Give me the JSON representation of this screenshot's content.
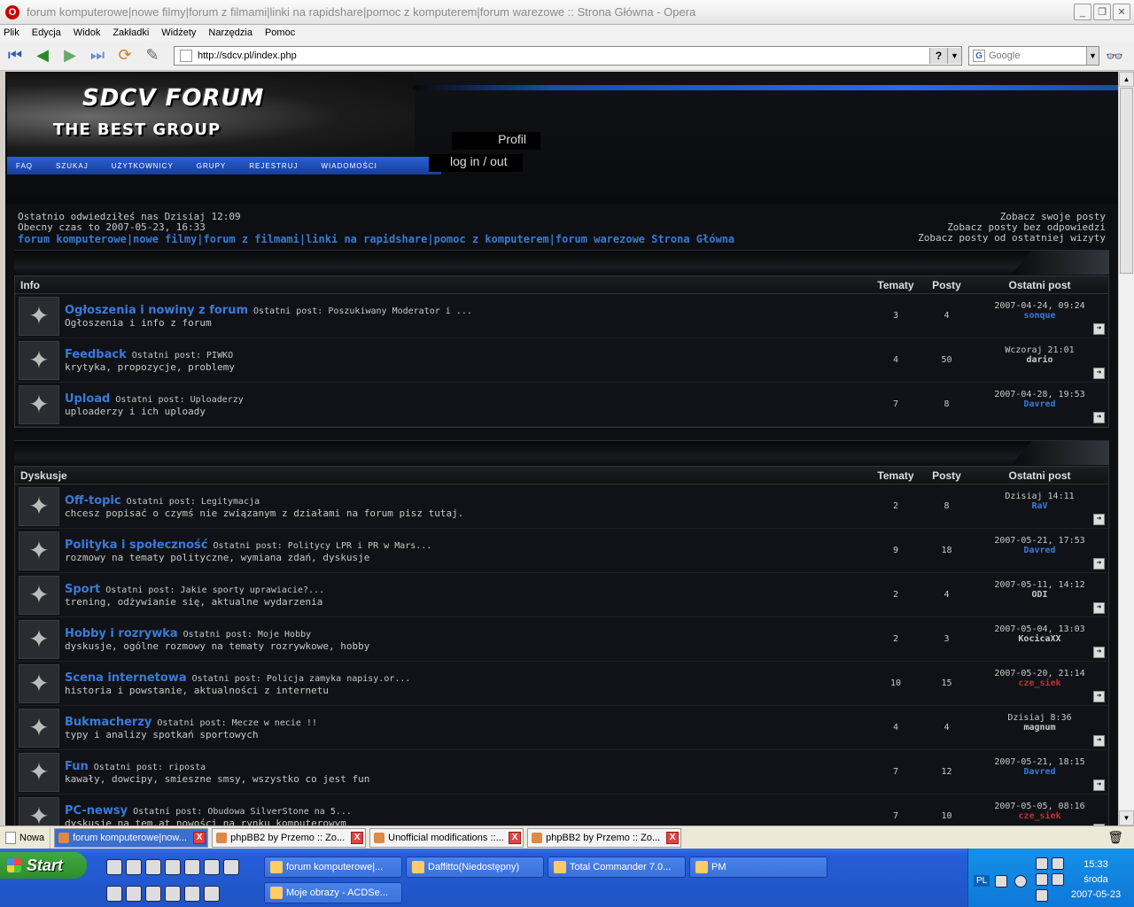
{
  "window": {
    "title": "forum komputerowe|nowe filmy|forum z filmami|linki na rapidshare|pomoc z komputerem|forum warezowe :: Strona Główna - Opera",
    "app_glyph": "O"
  },
  "menu": [
    "Plik",
    "Edycja",
    "Widok",
    "Zakładki",
    "Widżety",
    "Narzędzia",
    "Pomoc"
  ],
  "address": {
    "url": "http://sdcv.pl/index.php",
    "help": "?",
    "search_placeholder": "Google"
  },
  "header": {
    "logo_line1": "SDCV FORUM",
    "logo_line2": "THE BEST GROUP",
    "nav": [
      "FAQ",
      "SZUKAJ",
      "UŻYTKOWNICY",
      "GRUPY",
      "REJESTRUJ",
      "WIADOMOŚCI"
    ],
    "profil": "Profil",
    "login": "log in / out"
  },
  "info": {
    "last_visit": "Ostatnio odwiedziłeś nas Dzisiaj 12:09",
    "current_time": "Obecny czas to 2007-05-23, 16:33",
    "breadcrumb": "forum komputerowe|nowe filmy|forum z filmami|linki na rapidshare|pomoc z komputerem|forum warezowe Strona Główna",
    "links": [
      "Zobacz swoje posty",
      "Zobacz posty bez odpowiedzi",
      "Zobacz posty od ostatniej wizyty"
    ]
  },
  "columns": {
    "tematy": "Tematy",
    "posty": "Posty",
    "ostatni": "Ostatni post"
  },
  "categories": [
    {
      "name": "Info",
      "forums": [
        {
          "name": "Ogłoszenia i nowiny z forum",
          "last": "Ostatni post: Poszukiwany Moderator i ...",
          "desc": "Ogłoszenia i info z forum",
          "topics": "3",
          "posts": "4",
          "date": "2007-04-24, 09:24",
          "user": "sonque",
          "ucolor": "#3a7ad8"
        },
        {
          "name": "Feedback",
          "last": "Ostatni post: PIWKO",
          "desc": "krytyka, propozycje, problemy",
          "topics": "4",
          "posts": "50",
          "date": "Wczoraj 21:01",
          "user": "dario",
          "ucolor": "#c8c8c8"
        },
        {
          "name": "Upload",
          "last": "Ostatni post: Uploaderzy",
          "desc": "uploaderzy i ich uploady",
          "topics": "7",
          "posts": "8",
          "date": "2007-04-28, 19:53",
          "user": "Davred",
          "ucolor": "#3a7ad8"
        }
      ]
    },
    {
      "name": "Dyskusje",
      "forums": [
        {
          "name": "Off-topic",
          "last": "Ostatni post: Legitymacja",
          "desc": "chcesz popisać o czymś nie związanym z działami na forum pisz tutaj.",
          "topics": "2",
          "posts": "8",
          "date": "Dzisiaj 14:11",
          "user": "RaV",
          "ucolor": "#3a7ad8"
        },
        {
          "name": "Polityka i społeczność",
          "last": "Ostatni post: Politycy LPR i PR w Mars...",
          "desc": "rozmowy na tematy polityczne, wymiana zdań, dyskusje",
          "topics": "9",
          "posts": "18",
          "date": "2007-05-21, 17:53",
          "user": "Davred",
          "ucolor": "#3a7ad8"
        },
        {
          "name": "Sport",
          "last": "Ostatni post: Jakie sporty uprawiacie?...",
          "desc": "trening, odżywianie się, aktualne wydarzenia",
          "topics": "2",
          "posts": "4",
          "date": "2007-05-11, 14:12",
          "user": "ODI",
          "ucolor": "#c8c8c8"
        },
        {
          "name": "Hobby i rozrywka",
          "last": "Ostatni post: Moje Hobby",
          "desc": "dyskusje, ogólne rozmowy na tematy rozrywkowe, hobby",
          "topics": "2",
          "posts": "3",
          "date": "2007-05-04, 13:03",
          "user": "KocicaXX",
          "ucolor": "#c8c8c8"
        },
        {
          "name": "Scena internetowa",
          "last": "Ostatni post: Policja zamyka napisy.or...",
          "desc": "historia i powstanie, aktualności z internetu",
          "topics": "10",
          "posts": "15",
          "date": "2007-05-20, 21:14",
          "user": "cze_siek",
          "ucolor": "#c03030"
        },
        {
          "name": "Bukmacherzy",
          "last": "Ostatni post: Mecze w necie !!",
          "desc": "typy i analizy spotkań sportowych",
          "topics": "4",
          "posts": "4",
          "date": "Dzisiaj 8:36",
          "user": "magnum",
          "ucolor": "#c8c8c8"
        },
        {
          "name": "Fun",
          "last": "Ostatni post: riposta",
          "desc": "kawały, dowcipy, smieszne smsy, wszystko co jest fun",
          "topics": "7",
          "posts": "12",
          "date": "2007-05-21, 18:15",
          "user": "Davred",
          "ucolor": "#3a7ad8"
        },
        {
          "name": "PC-newsy",
          "last": "Ostatni post: Obudowa SilverStone na 5...",
          "desc": "dyskusje na tem.at nowości na rynku komputerowym",
          "topics": "7",
          "posts": "10",
          "date": "2007-05-05, 08:16",
          "user": "cze_siek",
          "ucolor": "#c03030"
        }
      ]
    }
  ],
  "tabs": {
    "new": "Nowa",
    "pages": [
      "forum komputerowe|now...",
      "phpBB2 by Przemo :: Zo...",
      "Unofficial modifications ::...",
      "phpBB2 by Przemo :: Zo..."
    ]
  },
  "taskbar": {
    "start": "Start",
    "buttons": [
      "forum komputerowe|...",
      "Daffitto(Niedostępny)",
      "Total Commander 7.0...",
      "PM",
      "Moje obrazy - ACDSe..."
    ],
    "lang": "PL",
    "time": "15:33",
    "day": "środa",
    "date": "2007-05-23"
  }
}
